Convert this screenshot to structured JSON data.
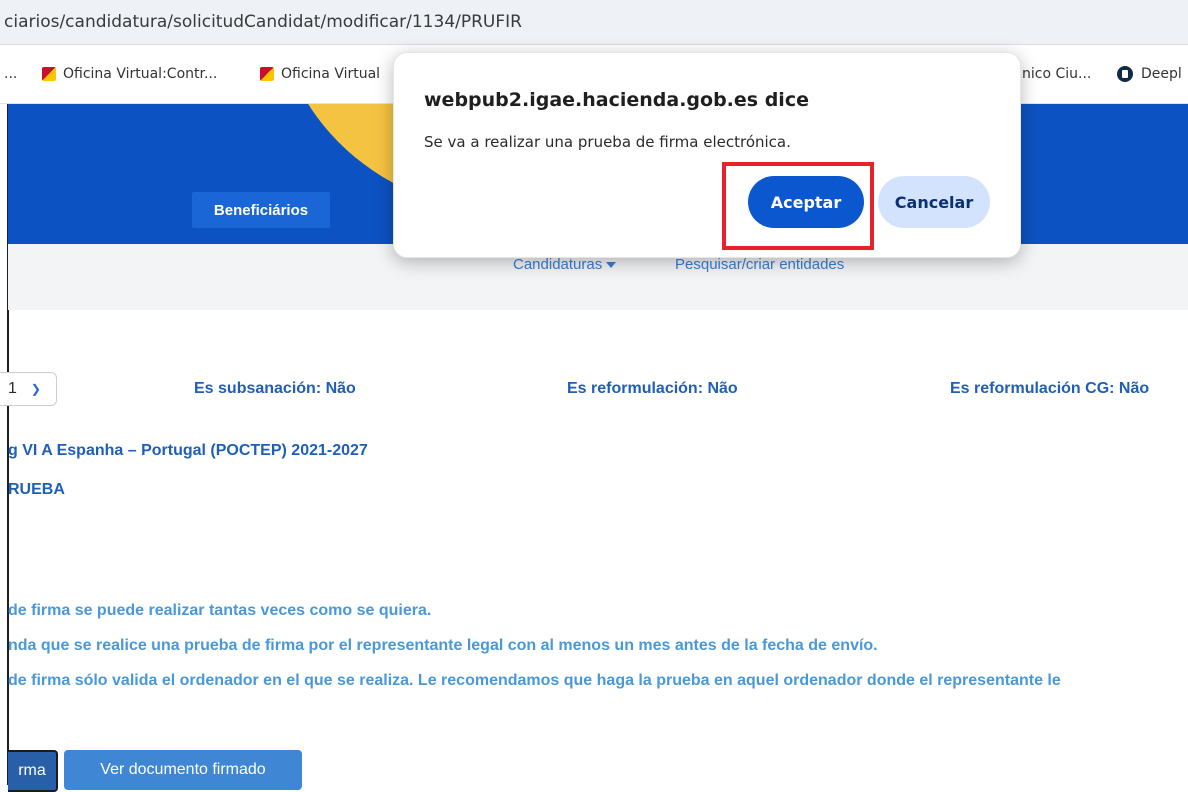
{
  "browser": {
    "url": "ciarios/candidatura/solicitudCandidat/modificar/1134/PRUFIR",
    "bookmarks": [
      {
        "label": "...",
        "icon": "none"
      },
      {
        "label": "Oficina Virtual:Contr...",
        "icon": "spain-coat-of-arms-icon"
      },
      {
        "label": "Oficina Virtual",
        "icon": "spain-coat-of-arms-icon"
      },
      {
        "label": "nico Ciu...",
        "icon": "none"
      },
      {
        "label": "Deepl",
        "icon": "deepl-icon"
      }
    ]
  },
  "header": {
    "tab_beneficiarios": "Beneficiários"
  },
  "subnav": {
    "candidaturas": "Candidaturas",
    "pesquisar": "Pesquisar/criar entidades"
  },
  "main": {
    "version_value": "1",
    "es_subsanacion": "Es subsanación: Não",
    "es_reformulacion": "Es reformulación: Não",
    "es_reformulacion_cg": "Es reformulación CG: Não",
    "programme": "g VI A Espanha – Portugal (POCTEP) 2021-2027",
    "name": "RUEBA",
    "info_lines": [
      "de firma se puede realizar tantas veces como se quiera.",
      "nda que se realice una prueba de firma por el representante legal con al menos un mes antes de la fecha de envío.",
      "de firma sólo valida el ordenador en el que se realiza. Le recomendamos que haga la prueba en aquel ordenador donde el representante le"
    ],
    "firma_button": "rma",
    "ver_documento_button": "Ver documento firmado"
  },
  "dialog": {
    "title": "webpub2.igae.hacienda.gob.es dice",
    "message": "Se va a realizar una prueba de firma electrónica.",
    "accept": "Aceptar",
    "cancel": "Cancelar",
    "highlight_color": "#e8222b"
  },
  "colors": {
    "header_blue": "#0d52c2",
    "accent_yellow": "#f5c342",
    "link_blue": "#1f5fb8",
    "primary_button": "#0b57d0"
  }
}
